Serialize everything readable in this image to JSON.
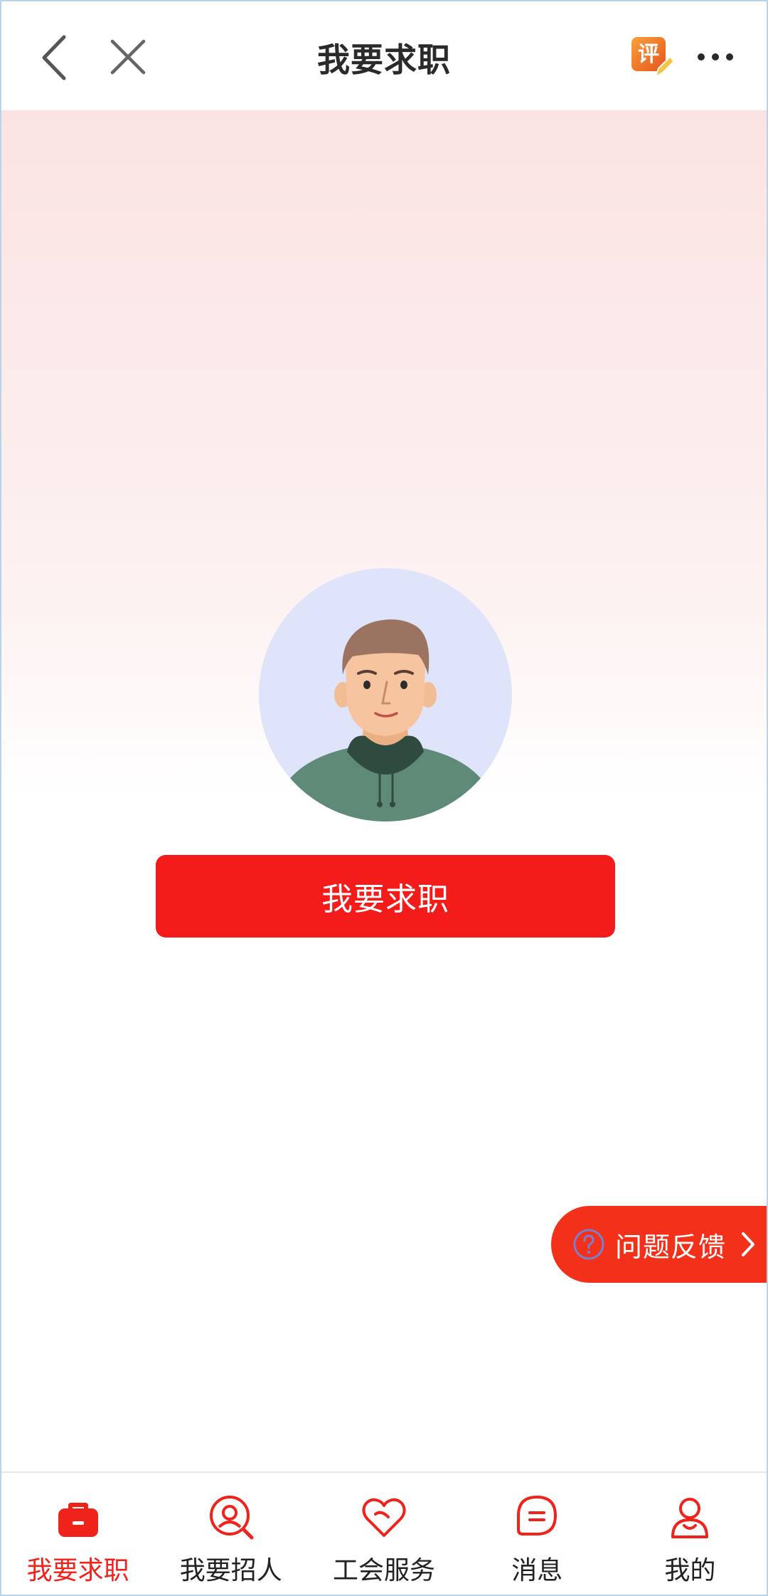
{
  "header": {
    "title": "我要求职",
    "back_icon": "chevron-left-icon",
    "close_icon": "close-icon",
    "review_badge": "评",
    "more_icon": "more-horizontal-icon"
  },
  "main": {
    "avatar": "male-avatar-illustration",
    "primary_button": "我要求职"
  },
  "feedback": {
    "label": "问题反馈",
    "icon": "question-circle-icon",
    "arrow": "chevron-right-icon"
  },
  "tabs": [
    {
      "label": "我要求职",
      "icon": "briefcase-icon",
      "active": true
    },
    {
      "label": "我要招人",
      "icon": "search-person-icon",
      "active": false
    },
    {
      "label": "工会服务",
      "icon": "heart-icon",
      "active": false
    },
    {
      "label": "消息",
      "icon": "message-icon",
      "active": false
    },
    {
      "label": "我的",
      "icon": "user-icon",
      "active": false
    }
  ],
  "colors": {
    "accent": "#f41c1a",
    "tab_active": "#f0221c",
    "feedback_bg": "#f3301a",
    "avatar_bg": "#dfe4fb"
  }
}
